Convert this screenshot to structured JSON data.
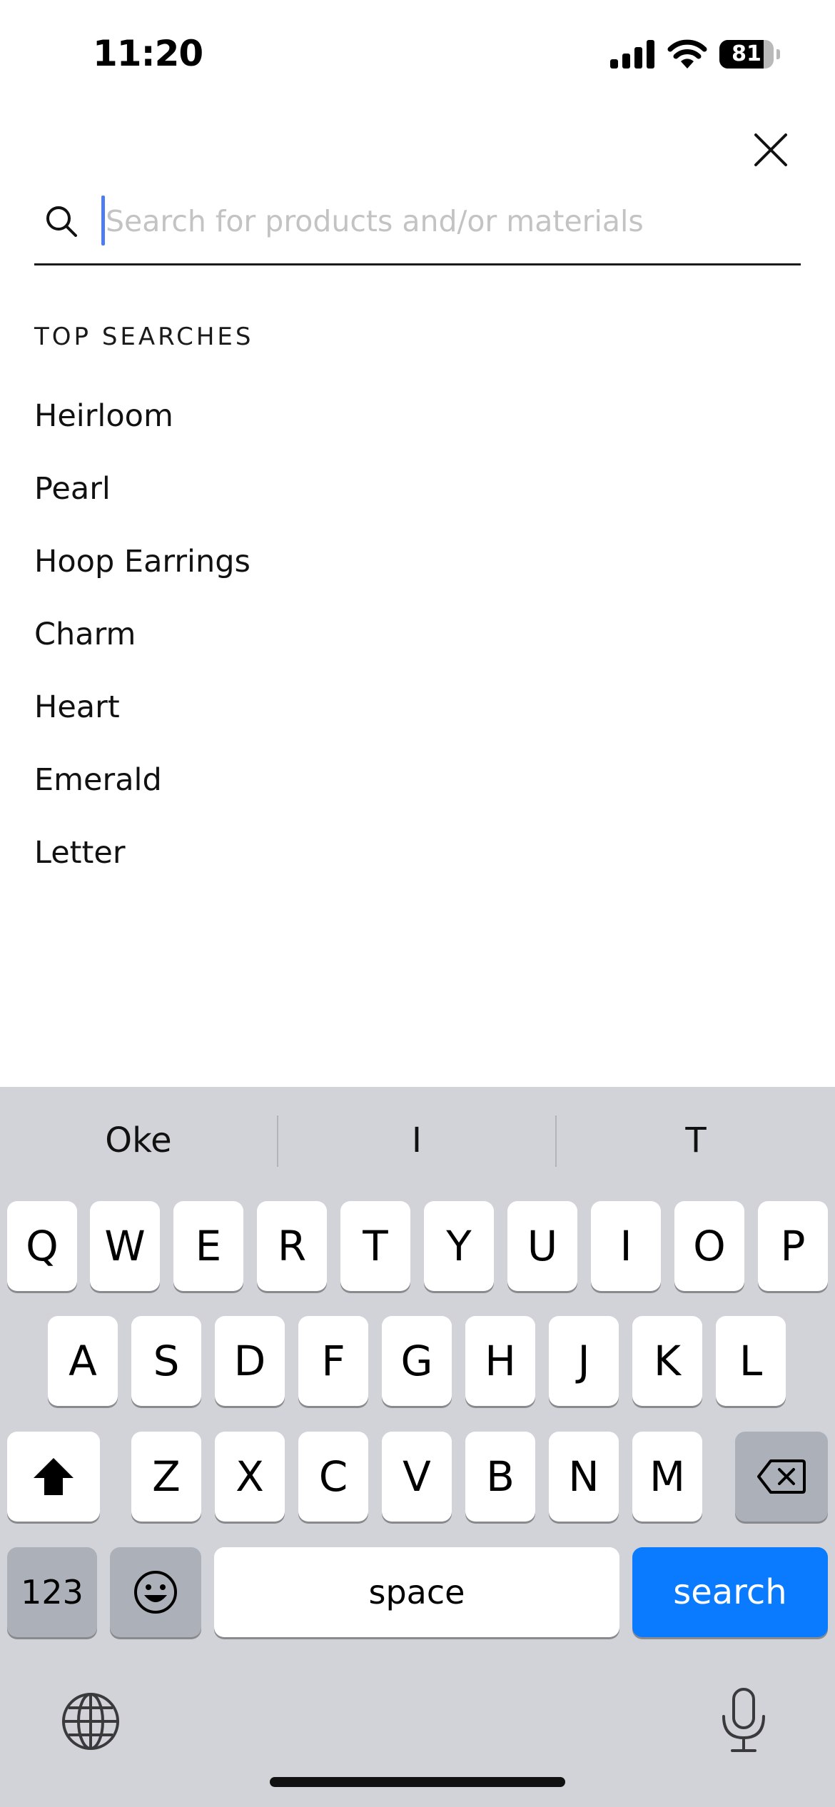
{
  "status_bar": {
    "time": "11:20",
    "battery_level": "81",
    "battery_fraction": 0.81
  },
  "search": {
    "placeholder": "Search for products and/or materials",
    "value": ""
  },
  "top_searches": {
    "heading": "TOP SEARCHES",
    "items": [
      "Heirloom",
      "Pearl",
      "Hoop Earrings",
      "Charm",
      "Heart",
      "Emerald",
      "Letter"
    ]
  },
  "keyboard": {
    "predictions": [
      "Oke",
      "I",
      "T"
    ],
    "row1": [
      "Q",
      "W",
      "E",
      "R",
      "T",
      "Y",
      "U",
      "I",
      "O",
      "P"
    ],
    "row2": [
      "A",
      "S",
      "D",
      "F",
      "G",
      "H",
      "J",
      "K",
      "L"
    ],
    "row3": [
      "Z",
      "X",
      "C",
      "V",
      "B",
      "N",
      "M"
    ],
    "numbers_label": "123",
    "space_label": "space",
    "return_label": "search",
    "return_color": "#0a7bff"
  },
  "icons": {
    "close": "close-icon",
    "search": "search-icon",
    "shift": "shift-icon",
    "delete": "delete-icon",
    "emoji": "emoji-icon",
    "globe": "globe-icon",
    "microphone": "microphone-icon"
  }
}
